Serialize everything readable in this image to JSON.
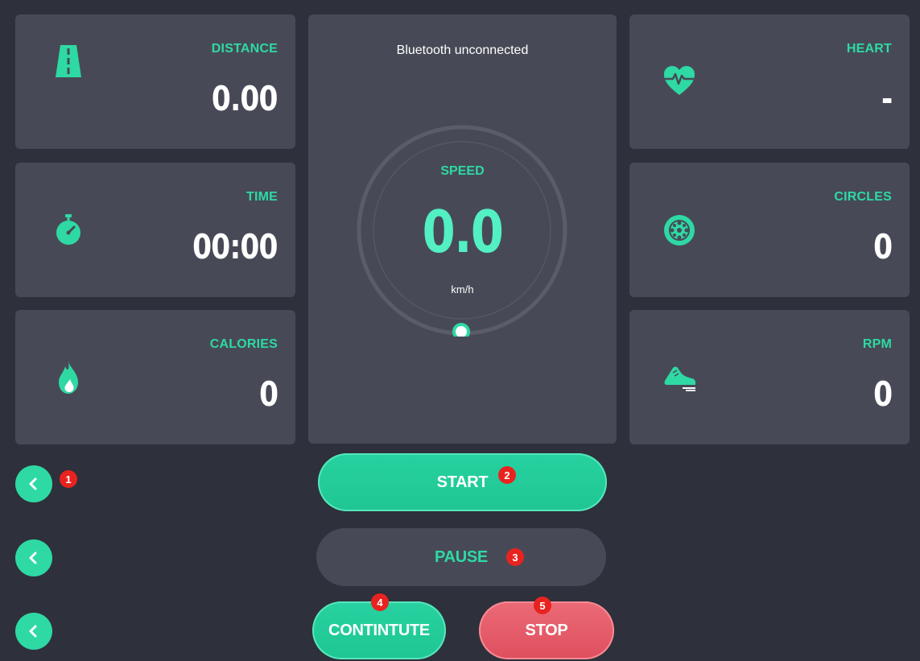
{
  "colors": {
    "background": "#2e303b",
    "card": "#474a56",
    "accent": "#2ed9a4",
    "speed_value": "#52f0c3",
    "stop": "#e05663",
    "badge": "#e8231f"
  },
  "bluetooth_status": "Bluetooth unconnected",
  "metrics": {
    "distance": {
      "label": "DISTANCE",
      "value": "0.00",
      "icon": "road-icon"
    },
    "time": {
      "label": "TIME",
      "value": "00:00",
      "icon": "stopwatch-icon"
    },
    "calories": {
      "label": "CALORIES",
      "value": "0",
      "icon": "flame-icon"
    },
    "heart": {
      "label": "HEART",
      "value": "-",
      "icon": "heart-rate-icon"
    },
    "circles": {
      "label": "CIRCLES",
      "value": "0",
      "icon": "wheel-icon"
    },
    "rpm": {
      "label": "RPM",
      "value": "0",
      "icon": "running-shoe-icon"
    }
  },
  "speed": {
    "label": "SPEED",
    "value": "0.0",
    "unit": "km/h",
    "level": 0
  },
  "buttons": {
    "start": "START",
    "pause": "PAUSE",
    "continue": "CONTINTUTE",
    "stop": "STOP"
  },
  "badges": [
    "1",
    "2",
    "3",
    "4",
    "5"
  ]
}
